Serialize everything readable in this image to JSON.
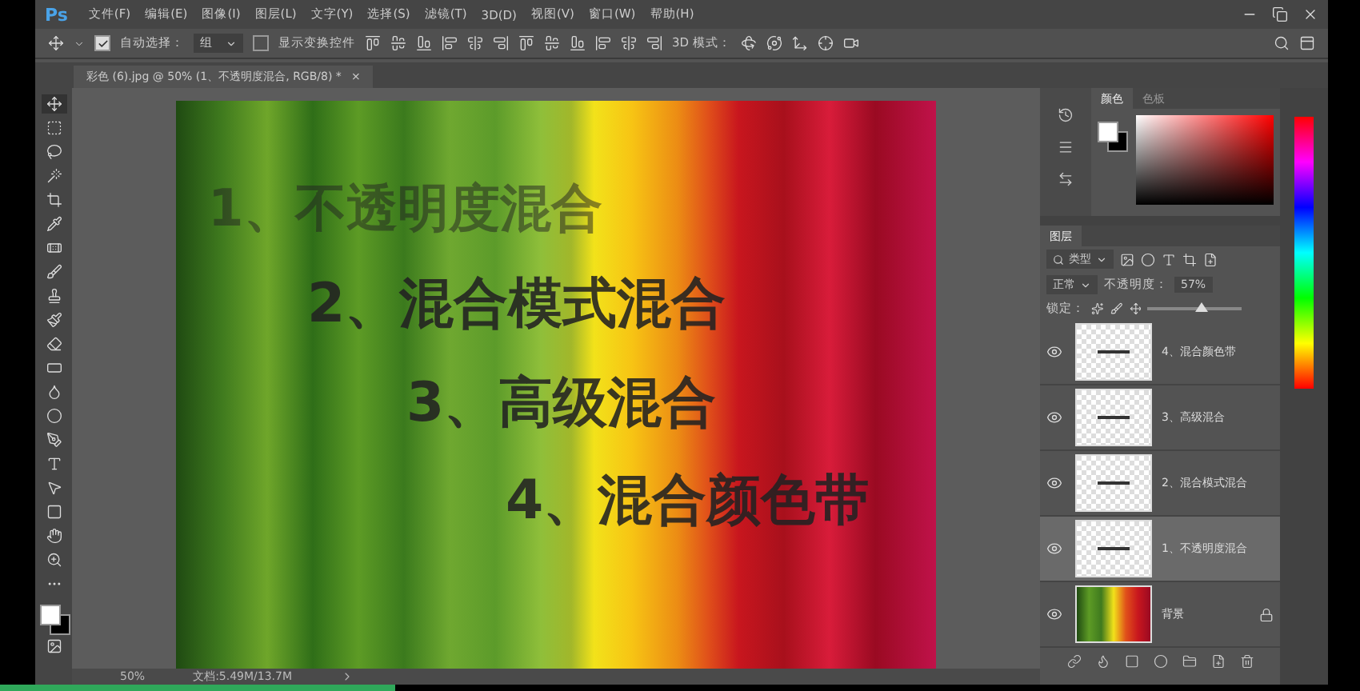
{
  "app": {
    "logo": "Ps"
  },
  "menu": [
    "文件(F)",
    "编辑(E)",
    "图像(I)",
    "图层(L)",
    "文字(Y)",
    "选择(S)",
    "滤镜(T)",
    "3D(D)",
    "视图(V)",
    "窗口(W)",
    "帮助(H)"
  ],
  "options_bar": {
    "auto_select": {
      "label": "自动选择：",
      "checked": true
    },
    "auto_select_target": "组",
    "show_transform": {
      "label": "显示变换控件",
      "checked": false
    },
    "mode_3d": "3D 模式："
  },
  "document_tab": {
    "title": "彩色 (6).jpg @ 50% (1、不透明度混合, RGB/8) *",
    "close": "×"
  },
  "canvas_texts": [
    {
      "text": "1、不透明度混合",
      "faded": true
    },
    {
      "text": "2、混合模式混合",
      "faded": false
    },
    {
      "text": "3、高级混合",
      "faded": false
    },
    {
      "text": "4、混合颜色带",
      "faded": false
    }
  ],
  "color_panel": {
    "tabs": [
      {
        "label": "颜色",
        "selected": true
      },
      {
        "label": "色板",
        "selected": false
      }
    ]
  },
  "layers_panel": {
    "tab": "图层",
    "filter": "类型",
    "blend_mode": "正常",
    "opacity_label": "不透明度：",
    "opacity": "57%",
    "opacity_slider": {
      "level": 0.57
    },
    "lock_label": "锁定：",
    "layers": [
      {
        "name": "4、混合颜色带",
        "kind": "text",
        "visible": true,
        "selected": false,
        "locked": false
      },
      {
        "name": "3、高级混合",
        "kind": "text",
        "visible": true,
        "selected": false,
        "locked": false
      },
      {
        "name": "2、混合模式混合",
        "kind": "text",
        "visible": true,
        "selected": false,
        "locked": false
      },
      {
        "name": "1、不透明度混合",
        "kind": "text",
        "visible": true,
        "selected": true,
        "locked": false
      },
      {
        "name": "背景",
        "kind": "image",
        "visible": true,
        "selected": false,
        "locked": true
      }
    ]
  },
  "status_bar": {
    "zoom": "50%",
    "doc_size": "文档:5.49M/13.7M"
  },
  "progress": {
    "level": 0.29
  }
}
